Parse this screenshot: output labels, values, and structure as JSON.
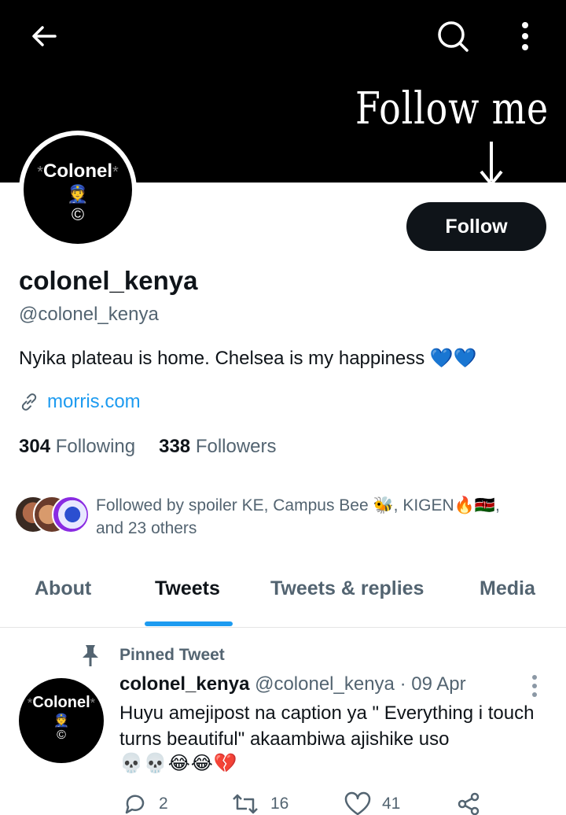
{
  "banner": {
    "text": "Follow me"
  },
  "nav": {
    "back_icon": "arrow-left-icon",
    "search_icon": "search-icon",
    "more_icon": "more-vertical-icon"
  },
  "profile": {
    "avatar": {
      "name": "Colonel",
      "emoji": "👮",
      "mark": "©"
    },
    "follow_label": "Follow",
    "display_name": "colonel_kenya",
    "handle": "@colonel_kenya",
    "bio": "Nyika plateau is home. Chelsea is my happiness 💙💙",
    "link": "morris.com",
    "following_count": "304",
    "following_label": "Following",
    "followers_count": "338",
    "followers_label": "Followers",
    "followed_by": "Followed by spoiler KE, Campus Bee 🐝, KIGEN🔥🇰🇪, and 23 others"
  },
  "tabs": [
    {
      "label": "About"
    },
    {
      "label": "Tweets"
    },
    {
      "label": "Tweets & replies"
    },
    {
      "label": "Media"
    }
  ],
  "active_tab": "Tweets",
  "pinned_tweet": {
    "pinned_label": "Pinned Tweet",
    "author_name": "colonel_kenya",
    "meta": "@colonel_kenya · 09 Apr",
    "text": "Huyu amejipost na caption ya \" Everything i touch turns beautiful\" akaambiwa ajishike uso",
    "emoji_line": "💀💀😂😂💔",
    "reply_count": "2",
    "retweet_count": "16",
    "like_count": "41"
  },
  "colors": {
    "accent": "#1d9bf0",
    "text": "#0f1419",
    "secondary": "#536471",
    "button": "#0f1419"
  }
}
